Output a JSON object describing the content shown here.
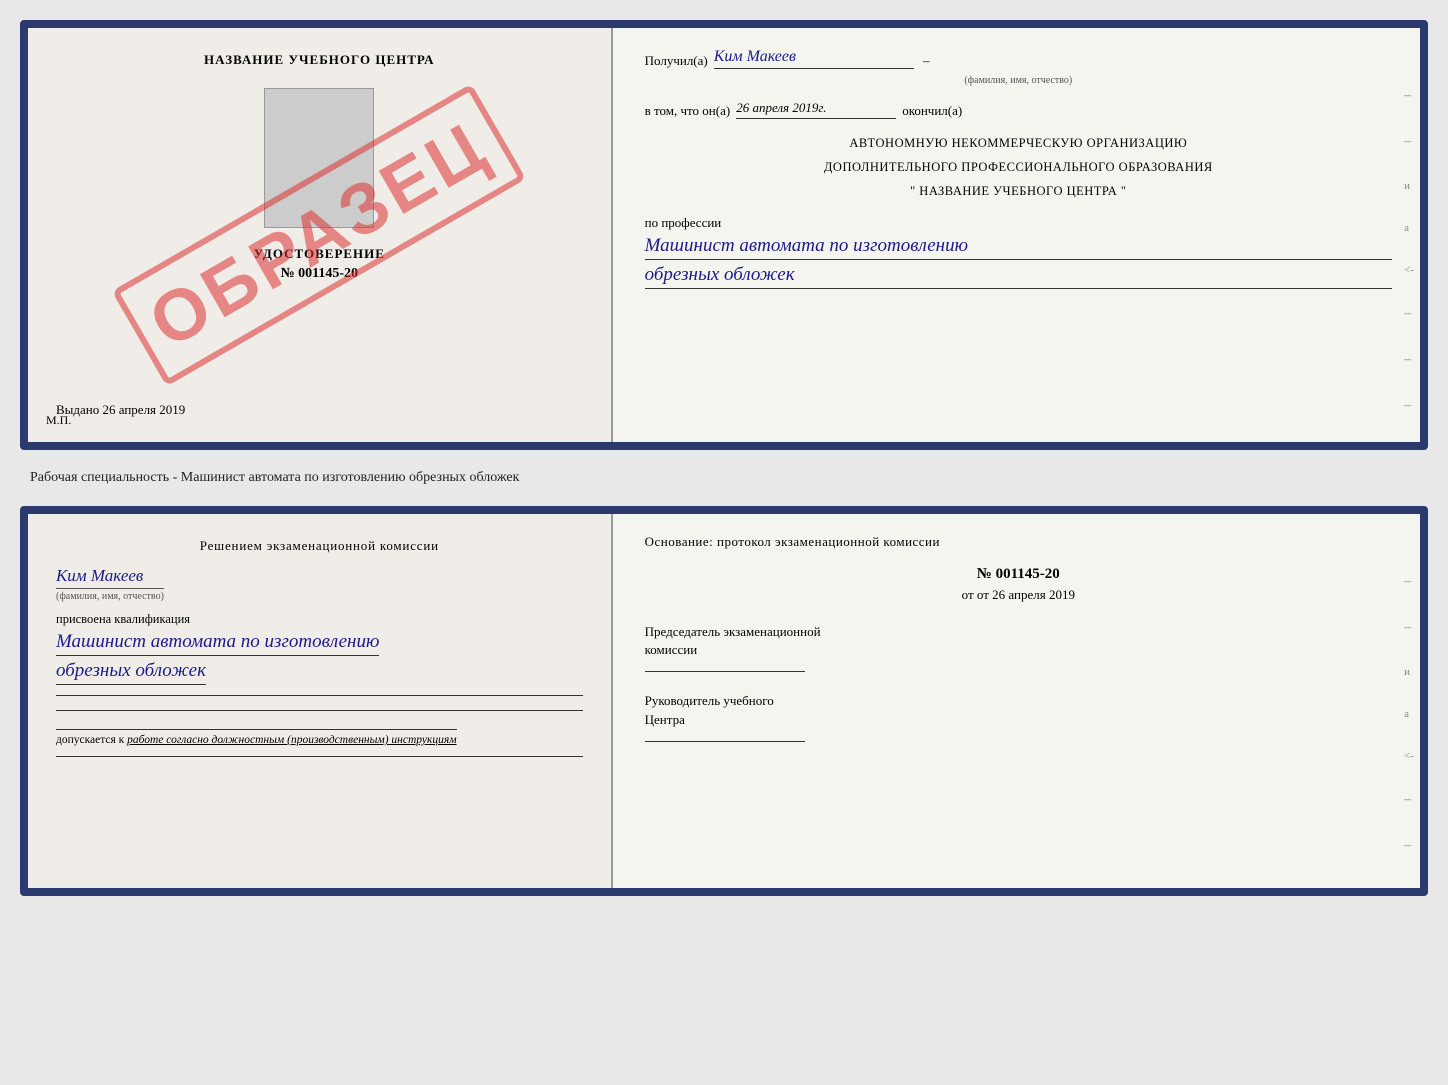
{
  "cert_top": {
    "left": {
      "school_name": "НАЗВАНИЕ УЧЕБНОГО ЦЕНТРА",
      "udostoverenie": "УДОСТОВЕРЕНИЕ",
      "number": "№ 001145-20",
      "stamp_text": "ОБРАЗЕЦ",
      "vydano": "Выдано 26 апреля 2019",
      "mp": "М.П."
    },
    "right": {
      "poluchil_label": "Получил(а)",
      "recipient_name": "Ким Макеев",
      "fio_hint": "(фамилия, имя, отчество)",
      "vtom_label": "в том, что он(а)",
      "date_value": "26 апреля 2019г.",
      "okonchil": "окончил(а)",
      "org_line1": "АВТОНОМНУЮ НЕКОММЕРЧЕСКУЮ ОРГАНИЗАЦИЮ",
      "org_line2": "ДОПОЛНИТЕЛЬНОГО ПРОФЕССИОНАЛЬНОГО ОБРАЗОВАНИЯ",
      "org_line3": "\"  НАЗВАНИЕ УЧЕБНОГО ЦЕНТРА  \"",
      "po_professii": "по профессии",
      "profession_line1": "Машинист автомата по изготовлению",
      "profession_line2": "обрезных обложек"
    }
  },
  "between": {
    "caption": "Рабочая специальность - Машинист автомата по изготовлению обрезных обложек"
  },
  "cert_bottom": {
    "left": {
      "komissia_header": "Решением экзаменационной комиссии",
      "name": "Ким Макеев",
      "fio_hint": "(фамилия, имя, отчество)",
      "prisvoena": "присвоена квалификация",
      "qualification_line1": "Машинист автомата по изготовлению",
      "qualification_line2": "обрезных обложек",
      "dopuskaetsa_text": "допускается к",
      "dopuskaetsa_detail": "работе согласно должностным (производственным) инструкциям"
    },
    "right": {
      "osnovanie": "Основание: протокол экзаменационной комиссии",
      "number": "№  001145-20",
      "ot": "от 26 апреля 2019",
      "predsedatel_label": "Председатель экзаменационной\nкомиссии",
      "rukovoditel_label": "Руководитель учебного\nЦентра"
    }
  }
}
